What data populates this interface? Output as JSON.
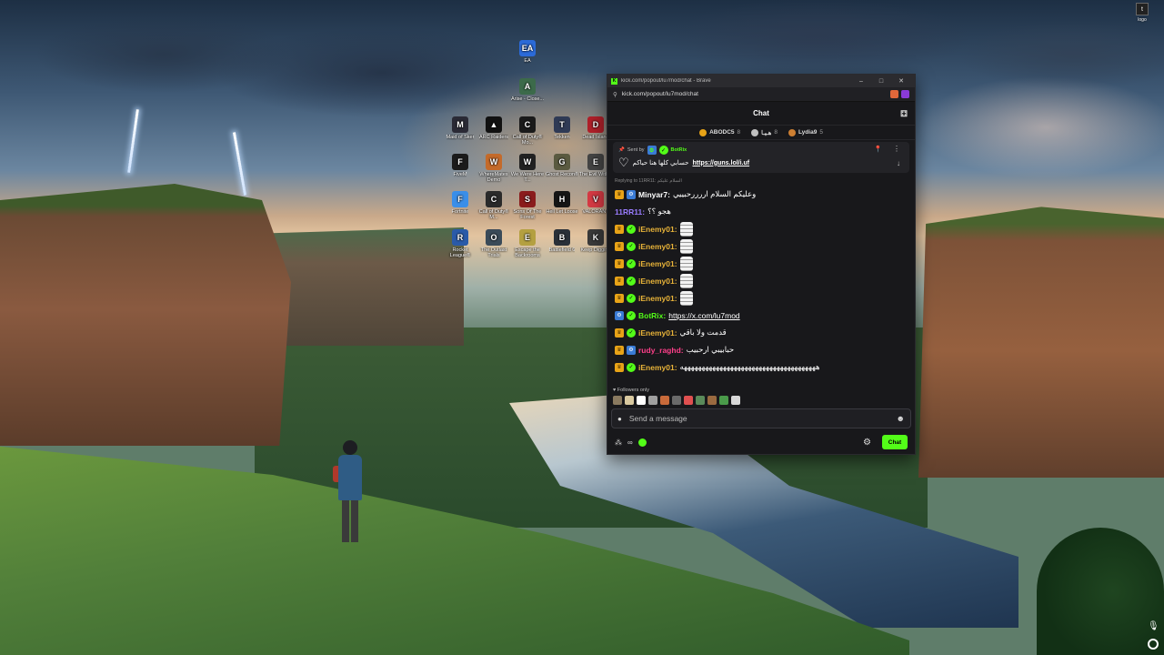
{
  "desktop": {
    "icons": [
      {
        "label": "EA",
        "icon": "ea-icon",
        "color": "#2b6ad8",
        "glyph": "EA"
      },
      {
        "label": "Arise - Close...",
        "icon": "arise-icon",
        "color": "#3c6a4a",
        "glyph": "A"
      },
      {
        "label": "Maid of Sker",
        "icon": "maid-of-sker-icon",
        "color": "#2a2a35",
        "glyph": "M"
      },
      {
        "label": "ARC Raiders",
        "icon": "arc-raiders-icon",
        "color": "#111111",
        "glyph": "▲"
      },
      {
        "label": "Call of Duty® Mo...",
        "icon": "cod-icon",
        "color": "#1a1a1a",
        "glyph": "C"
      },
      {
        "label": "Tekken",
        "icon": "tekken-icon",
        "color": "#2f3a55",
        "glyph": "T"
      },
      {
        "label": "Dead Island",
        "icon": "dead-island-icon",
        "color": "#b0202a",
        "glyph": "D"
      },
      {
        "label": "FiveM",
        "icon": "fivem-icon",
        "color": "#1b1b1b",
        "glyph": "F"
      },
      {
        "label": "WhereMates Demo",
        "icon": "wheremates-icon",
        "color": "#c46a2a",
        "glyph": "W"
      },
      {
        "label": "We Were Here T...",
        "icon": "we-were-here-icon",
        "color": "#222222",
        "glyph": "W"
      },
      {
        "label": "Ghost Recon®",
        "icon": "ghost-recon-icon",
        "color": "#5a5a40",
        "glyph": "G"
      },
      {
        "label": "The Evil Within",
        "icon": "evil-within-icon",
        "color": "#444444",
        "glyph": "E"
      },
      {
        "label": "Fortnite",
        "icon": "fortnite-icon",
        "color": "#3a8ee8",
        "glyph": "F"
      },
      {
        "label": "Call of Duty® M...",
        "icon": "cod-mw-icon",
        "color": "#2a2a2a",
        "glyph": "C"
      },
      {
        "label": "Sons Of The Forest",
        "icon": "sons-forest-icon",
        "color": "#8a1c1c",
        "glyph": "S"
      },
      {
        "label": "Hell Let Loose",
        "icon": "hell-let-loose-icon",
        "color": "#151515",
        "glyph": "H"
      },
      {
        "label": "VALORANT",
        "icon": "valorant-icon",
        "color": "#d63a44",
        "glyph": "V"
      },
      {
        "label": "Rocket League®",
        "icon": "rocket-league-icon",
        "color": "#2a5aa8",
        "glyph": "R"
      },
      {
        "label": "The Outlast Trials",
        "icon": "outlast-icon",
        "color": "#3a4a58",
        "glyph": "O"
      },
      {
        "label": "Escape the Backrooms",
        "icon": "backrooms-icon",
        "color": "#b4a040",
        "glyph": "E"
      },
      {
        "label": "Battlefield 6",
        "icon": "battlefield-icon",
        "color": "#2a3038",
        "glyph": "B"
      },
      {
        "label": "Keep Digging",
        "icon": "keep-digging-icon",
        "color": "#3a3a3a",
        "glyph": "K"
      }
    ],
    "logo_label": "logo"
  },
  "browser": {
    "window_title": "kick.com/popout/lu7mod/chat - Brave",
    "url": "kick.com/popout/lu7mod/chat",
    "window_controls": {
      "minimize": "–",
      "maximize": "□",
      "close": "✕"
    }
  },
  "chat": {
    "header_title": "Chat",
    "leaderboard": [
      {
        "name": "ABODC5",
        "count": "8",
        "color": "#e8a317"
      },
      {
        "name": "هـيـا",
        "count": "8",
        "color": "#c0c0c0"
      },
      {
        "name": "Lydia9",
        "count": "5",
        "color": "#cd7f32"
      }
    ],
    "pinned": {
      "sent_by_label": "Sent by",
      "sender": "BotRix",
      "message": "حسابي كلها هنا حياكم",
      "link": "https://guns.lol/i.uf"
    },
    "reply_hint": "Replying to 11RR11: السلام عليكم",
    "messages": [
      {
        "user": "Minyar7",
        "color": "#ffffff",
        "badges": [
          "crown",
          "bot"
        ],
        "text": "وعليكم السلام اررررحبييي",
        "link": "",
        "emote": false
      },
      {
        "user": "11RR11",
        "color": "#9a7cff",
        "badges": [],
        "text": "هجو ؟؟",
        "link": "",
        "emote": false
      },
      {
        "user": "iEnemy01",
        "color": "#e8b339",
        "badges": [
          "crown",
          "verified"
        ],
        "text": "",
        "link": "",
        "emote": true
      },
      {
        "user": "iEnemy01",
        "color": "#e8b339",
        "badges": [
          "crown",
          "verified"
        ],
        "text": "",
        "link": "",
        "emote": true
      },
      {
        "user": "iEnemy01",
        "color": "#e8b339",
        "badges": [
          "crown",
          "verified"
        ],
        "text": "",
        "link": "",
        "emote": true
      },
      {
        "user": "iEnemy01",
        "color": "#e8b339",
        "badges": [
          "crown",
          "verified"
        ],
        "text": "",
        "link": "",
        "emote": true
      },
      {
        "user": "iEnemy01",
        "color": "#e8b339",
        "badges": [
          "crown",
          "verified"
        ],
        "text": "",
        "link": "",
        "emote": true
      },
      {
        "user": "BotRix",
        "color": "#53fc18",
        "badges": [
          "bot",
          "verified"
        ],
        "text": "",
        "link": "https://x.com/lu7mod",
        "emote": false
      },
      {
        "user": "iEnemy01",
        "color": "#e8b339",
        "badges": [
          "crown",
          "verified"
        ],
        "text": "قدمت ولا باقي",
        "link": "",
        "emote": false
      },
      {
        "user": "rudy_raghd",
        "color": "#ff3f8a",
        "badges": [
          "crown",
          "bot"
        ],
        "text": "حبابيبي ارحبيب",
        "link": "",
        "emote": false
      },
      {
        "user": "iEnemy01",
        "color": "#e8b339",
        "badges": [
          "crown",
          "verified"
        ],
        "text": "ههههههههههههههههههههههههههههههههههههههه",
        "link": "",
        "emote": false
      }
    ],
    "followers_only_label": "Followers only",
    "emote_colors": [
      "#8a7a60",
      "#d9c9a0",
      "#ffffff",
      "#a0a0a0",
      "#c86a3a",
      "#6a6a6a",
      "#e05050",
      "#5a8a5a",
      "#9a6a40",
      "#4a9a4a",
      "#d8d8d8"
    ],
    "input_placeholder": "Send a message",
    "points_label": "∞",
    "send_label": "Chat"
  }
}
